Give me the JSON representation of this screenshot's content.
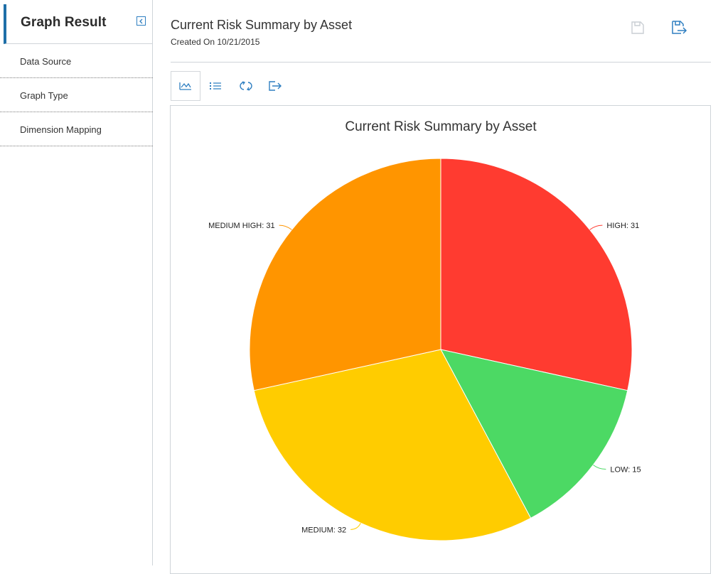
{
  "sidebar": {
    "title": "Graph Result",
    "items": [
      {
        "label": "Data Source"
      },
      {
        "label": "Graph Type"
      },
      {
        "label": "Dimension Mapping"
      }
    ]
  },
  "header": {
    "title": "Current Risk Summary by Asset",
    "subtitle": "Created On 10/21/2015",
    "icons": [
      "save-icon",
      "save-as-icon"
    ]
  },
  "toolbar": {
    "icons": [
      "chart-view-icon",
      "list-view-icon",
      "refresh-icon",
      "export-icon"
    ]
  },
  "colors": {
    "accent": "#1e6fa8",
    "high": "#ff3b30",
    "low": "#4cd964",
    "medium": "#ffcc00",
    "medium_high": "#ff9500"
  },
  "chart_data": {
    "type": "pie",
    "title": "Current Risk Summary by Asset",
    "slices": [
      {
        "label": "HIGH",
        "value": 31,
        "color": "#ff3b30",
        "display": "HIGH: 31"
      },
      {
        "label": "LOW",
        "value": 15,
        "color": "#4cd964",
        "display": "LOW: 15"
      },
      {
        "label": "MEDIUM",
        "value": 32,
        "color": "#ffcc00",
        "display": "MEDIUM: 32"
      },
      {
        "label": "MEDIUM HIGH",
        "value": 31,
        "color": "#ff9500",
        "display": "MEDIUM HIGH: 31"
      }
    ]
  }
}
